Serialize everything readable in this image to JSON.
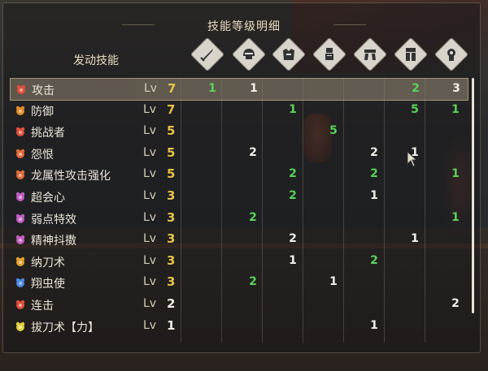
{
  "title": "技能等级明细",
  "header_label": "发动技能",
  "columns": [
    {
      "icon": "weapon-icon"
    },
    {
      "icon": "helm-icon"
    },
    {
      "icon": "chest-icon"
    },
    {
      "icon": "arms-icon"
    },
    {
      "icon": "waist-icon"
    },
    {
      "icon": "legs-icon"
    },
    {
      "icon": "talisman-icon"
    }
  ],
  "lv_label": "Lv",
  "skills": [
    {
      "name": "攻击",
      "color": "#e0503a",
      "level": "7",
      "level_color": "y",
      "highlight": true,
      "cells": [
        {
          "v": "1",
          "c": "g"
        },
        {
          "v": "1",
          "c": "w"
        },
        {
          "v": "",
          "c": ""
        },
        {
          "v": "",
          "c": ""
        },
        {
          "v": "",
          "c": ""
        },
        {
          "v": "2",
          "c": "g"
        },
        {
          "v": "3",
          "c": "w"
        }
      ]
    },
    {
      "name": "防御",
      "color": "#e08a2a",
      "level": "7",
      "level_color": "y",
      "cells": [
        {
          "v": "",
          "c": ""
        },
        {
          "v": "",
          "c": ""
        },
        {
          "v": "1",
          "c": "g"
        },
        {
          "v": "",
          "c": ""
        },
        {
          "v": "",
          "c": ""
        },
        {
          "v": "5",
          "c": "g"
        },
        {
          "v": "1",
          "c": "g"
        }
      ]
    },
    {
      "name": "挑战者",
      "color": "#e0503a",
      "level": "5",
      "level_color": "y",
      "cells": [
        {
          "v": "",
          "c": ""
        },
        {
          "v": "",
          "c": ""
        },
        {
          "v": "",
          "c": ""
        },
        {
          "v": "5",
          "c": "g"
        },
        {
          "v": "",
          "c": ""
        },
        {
          "v": "",
          "c": ""
        },
        {
          "v": "",
          "c": ""
        }
      ]
    },
    {
      "name": "怨恨",
      "color": "#e06a3a",
      "level": "5",
      "level_color": "y",
      "cells": [
        {
          "v": "",
          "c": ""
        },
        {
          "v": "2",
          "c": "w"
        },
        {
          "v": "",
          "c": ""
        },
        {
          "v": "",
          "c": ""
        },
        {
          "v": "2",
          "c": "w"
        },
        {
          "v": "1",
          "c": "w"
        },
        {
          "v": "",
          "c": ""
        }
      ]
    },
    {
      "name": "龙属性攻击强化",
      "color": "#e06a3a",
      "level": "5",
      "level_color": "y",
      "cells": [
        {
          "v": "",
          "c": ""
        },
        {
          "v": "",
          "c": ""
        },
        {
          "v": "2",
          "c": "g"
        },
        {
          "v": "",
          "c": ""
        },
        {
          "v": "2",
          "c": "g"
        },
        {
          "v": "",
          "c": ""
        },
        {
          "v": "1",
          "c": "g"
        }
      ]
    },
    {
      "name": "超会心",
      "color": "#c060c0",
      "level": "3",
      "level_color": "y",
      "cells": [
        {
          "v": "",
          "c": ""
        },
        {
          "v": "",
          "c": ""
        },
        {
          "v": "2",
          "c": "g"
        },
        {
          "v": "",
          "c": ""
        },
        {
          "v": "1",
          "c": "w"
        },
        {
          "v": "",
          "c": ""
        },
        {
          "v": "",
          "c": ""
        }
      ]
    },
    {
      "name": "弱点特效",
      "color": "#c060c0",
      "level": "3",
      "level_color": "y",
      "cells": [
        {
          "v": "",
          "c": ""
        },
        {
          "v": "2",
          "c": "g"
        },
        {
          "v": "",
          "c": ""
        },
        {
          "v": "",
          "c": ""
        },
        {
          "v": "",
          "c": ""
        },
        {
          "v": "",
          "c": ""
        },
        {
          "v": "1",
          "c": "g"
        }
      ]
    },
    {
      "name": "精神抖擞",
      "color": "#c060c0",
      "level": "3",
      "level_color": "y",
      "cells": [
        {
          "v": "",
          "c": ""
        },
        {
          "v": "",
          "c": ""
        },
        {
          "v": "2",
          "c": "w"
        },
        {
          "v": "",
          "c": ""
        },
        {
          "v": "",
          "c": ""
        },
        {
          "v": "1",
          "c": "w"
        },
        {
          "v": "",
          "c": ""
        }
      ]
    },
    {
      "name": "纳刀术",
      "color": "#e0a030",
      "level": "3",
      "level_color": "y",
      "cells": [
        {
          "v": "",
          "c": ""
        },
        {
          "v": "",
          "c": ""
        },
        {
          "v": "1",
          "c": "w"
        },
        {
          "v": "",
          "c": ""
        },
        {
          "v": "2",
          "c": "g"
        },
        {
          "v": "",
          "c": ""
        },
        {
          "v": "",
          "c": ""
        }
      ]
    },
    {
      "name": "翔虫使",
      "color": "#4a8ae0",
      "level": "3",
      "level_color": "y",
      "cells": [
        {
          "v": "",
          "c": ""
        },
        {
          "v": "2",
          "c": "g"
        },
        {
          "v": "",
          "c": ""
        },
        {
          "v": "1",
          "c": "w"
        },
        {
          "v": "",
          "c": ""
        },
        {
          "v": "",
          "c": ""
        },
        {
          "v": "",
          "c": ""
        }
      ]
    },
    {
      "name": "连击",
      "color": "#e0503a",
      "level": "2",
      "level_color": "w",
      "cells": [
        {
          "v": "",
          "c": ""
        },
        {
          "v": "",
          "c": ""
        },
        {
          "v": "",
          "c": ""
        },
        {
          "v": "",
          "c": ""
        },
        {
          "v": "",
          "c": ""
        },
        {
          "v": "",
          "c": ""
        },
        {
          "v": "2",
          "c": "w"
        }
      ]
    },
    {
      "name": "拔刀术【力】",
      "color": "#e0d040",
      "level": "1",
      "level_color": "w",
      "cells": [
        {
          "v": "",
          "c": ""
        },
        {
          "v": "",
          "c": ""
        },
        {
          "v": "",
          "c": ""
        },
        {
          "v": "",
          "c": ""
        },
        {
          "v": "1",
          "c": "w"
        },
        {
          "v": "",
          "c": ""
        },
        {
          "v": "",
          "c": ""
        }
      ]
    }
  ]
}
